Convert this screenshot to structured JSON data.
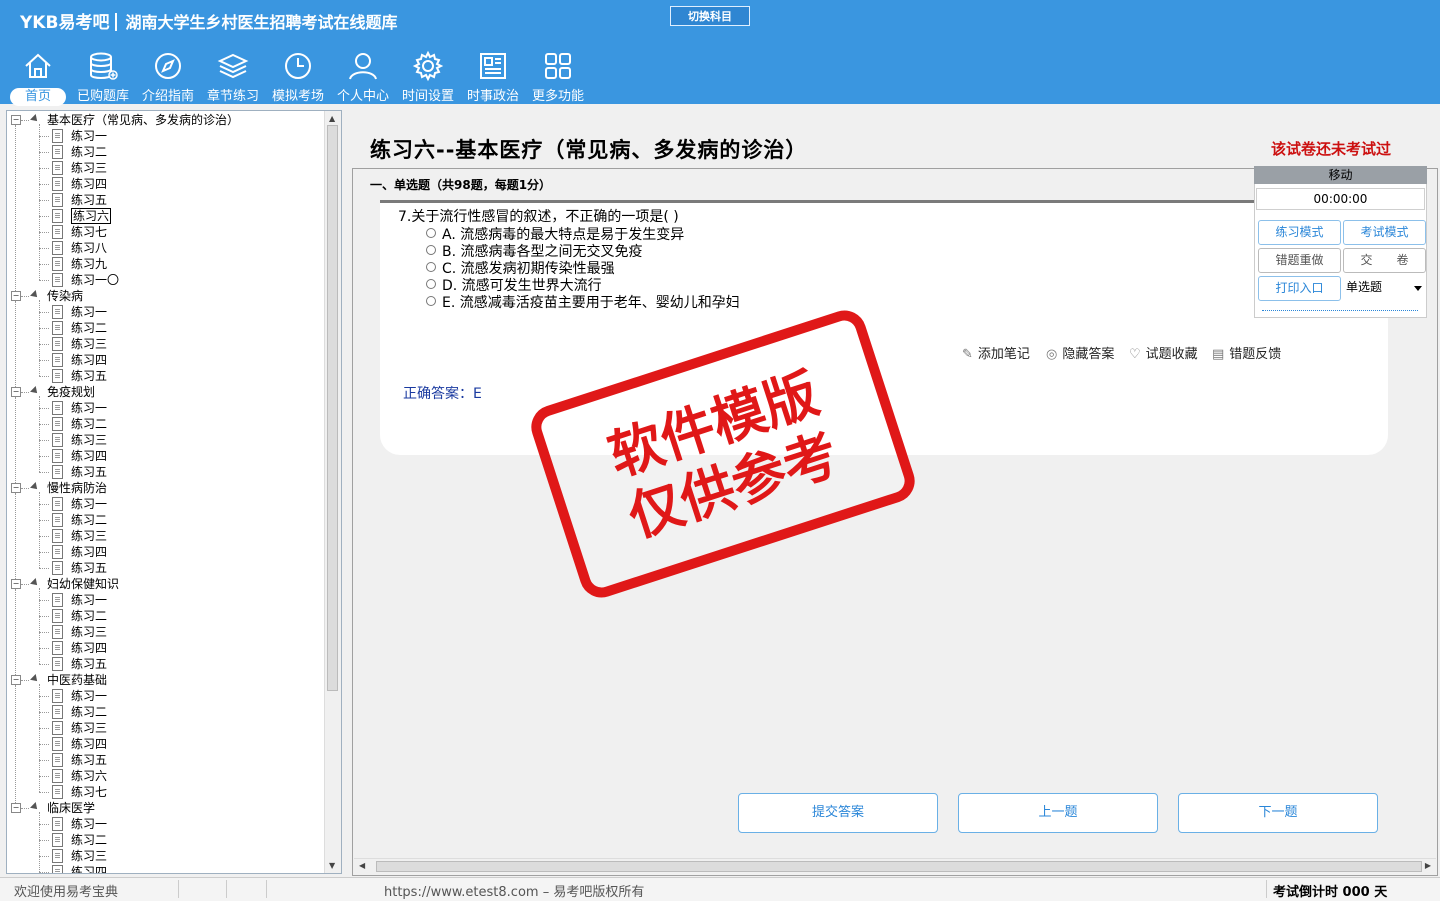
{
  "header": {
    "brand": "YKB易考吧",
    "title": "湖南大学生乡村医生招聘考试在线题库",
    "switch_label": "切换科目",
    "nav": [
      {
        "label": "首页",
        "icon": "home-icon",
        "active": true
      },
      {
        "label": "已购题库",
        "icon": "database-icon"
      },
      {
        "label": "介绍指南",
        "icon": "compass-icon"
      },
      {
        "label": "章节练习",
        "icon": "layers-icon"
      },
      {
        "label": "模拟考场",
        "icon": "clock-icon"
      },
      {
        "label": "个人中心",
        "icon": "user-icon"
      },
      {
        "label": "时间设置",
        "icon": "gear-icon"
      },
      {
        "label": "时事政治",
        "icon": "news-icon"
      },
      {
        "label": "更多功能",
        "icon": "grid-icon"
      }
    ]
  },
  "tree": [
    {
      "label": "基本医疗（常见病、多发病的诊治）",
      "children": [
        "练习一",
        "练习二",
        "练习三",
        "练习四",
        "练习五",
        "练习六",
        "练习七",
        "练习八",
        "练习九",
        "练习一〇"
      ],
      "selected": 5
    },
    {
      "label": "传染病",
      "children": [
        "练习一",
        "练习二",
        "练习三",
        "练习四",
        "练习五"
      ]
    },
    {
      "label": "免疫规划",
      "children": [
        "练习一",
        "练习二",
        "练习三",
        "练习四",
        "练习五"
      ]
    },
    {
      "label": "慢性病防治",
      "children": [
        "练习一",
        "练习二",
        "练习三",
        "练习四",
        "练习五"
      ]
    },
    {
      "label": "妇幼保健知识",
      "children": [
        "练习一",
        "练习二",
        "练习三",
        "练习四",
        "练习五"
      ]
    },
    {
      "label": "中医药基础",
      "children": [
        "练习一",
        "练习二",
        "练习三",
        "练习四",
        "练习五",
        "练习六",
        "练习七"
      ]
    },
    {
      "label": "临床医学",
      "children": [
        "练习一",
        "练习二",
        "练习三",
        "练习四"
      ]
    }
  ],
  "exam": {
    "title": "练习六--基本医疗（常见病、多发病的诊治）",
    "status": "该试卷还未考试过",
    "section": "一、单选题（共98题，每题1分）",
    "question": "7.关于流行性感冒的叙述，不正确的一项是(  )",
    "options": [
      "A. 流感病毒的最大特点是易于发生变异",
      "B. 流感病毒各型之间无交叉免疫",
      "C. 流感发病初期传染性最强",
      "D. 流感可发生世界大流行",
      "E. 流感减毒活疫苗主要用于老年、婴幼儿和孕妇"
    ],
    "tools": {
      "note": "添加笔记",
      "hide": "隐藏答案",
      "fav": "试题收藏",
      "feedback": "错题反馈"
    },
    "answer": "正确答案：E"
  },
  "panel": {
    "move": "移动",
    "timer": "00:00:00",
    "practice_mode": "练习模式",
    "exam_mode": "考试模式",
    "redo_wrong": "错题重做",
    "submit_paper": "交　　卷",
    "print": "打印入口",
    "qtype": "单选题"
  },
  "buttons": {
    "submit": "提交答案",
    "prev": "上一题",
    "next": "下一题"
  },
  "status": {
    "welcome": "欢迎使用易考宝典",
    "copyright": "https://www.etest8.com – 易考吧版权所有",
    "countdown": "考试倒计时 000 天"
  },
  "watermark": {
    "line1": "软件模版",
    "line2": "仅供参考"
  }
}
